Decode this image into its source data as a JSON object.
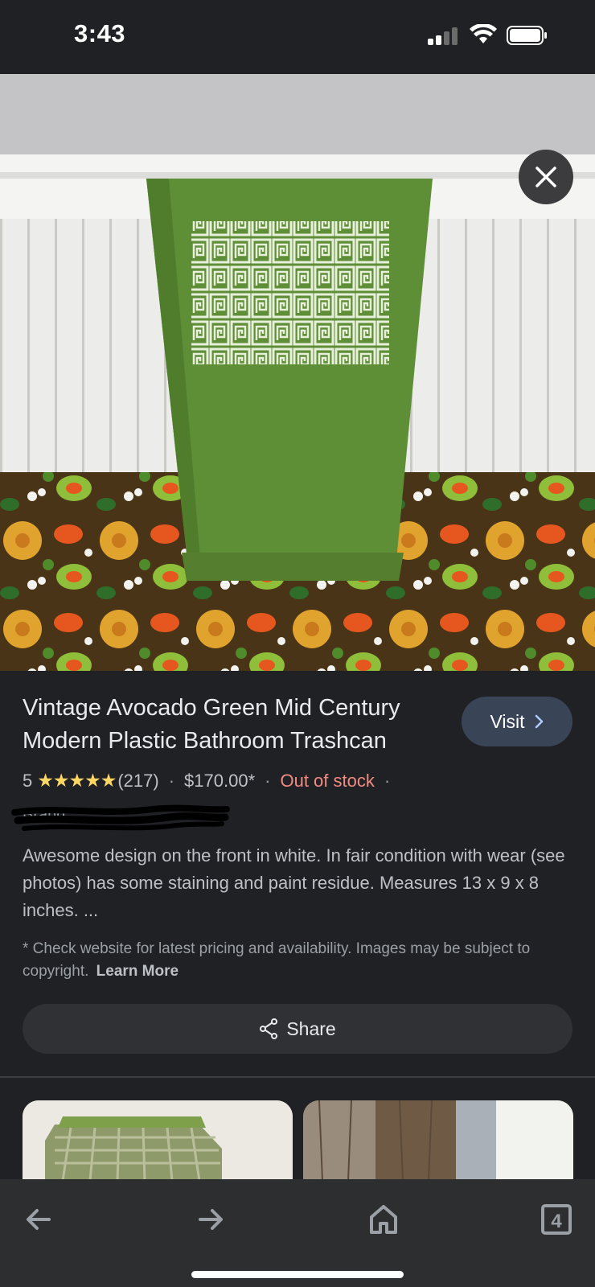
{
  "status_bar": {
    "time": "3:43"
  },
  "product": {
    "title": "Vintage Avocado Green Mid Century Modern Plastic Bathroom Trashcan",
    "rating": "5",
    "stars": "★★★★★",
    "review_count": "(217)",
    "price": "$170.00*",
    "availability": "Out of stock",
    "brand_label": "Brand",
    "description": "Awesome design on the front in white. In fair condition with wear (see photos) has some staining and paint residue. Measures 13 x 9 x 8 inches. ..."
  },
  "visit_button": {
    "label": "Visit"
  },
  "disclaimer": {
    "text": "* Check website for latest pricing and availability. Images may be subject to copyright.",
    "link": "Learn More"
  },
  "share_button": {
    "label": "Share"
  },
  "bottom_nav": {
    "tab_count": "4"
  },
  "icons": {
    "close": "close-icon",
    "visit": "chevron-right-icon",
    "share": "share-icon",
    "back": "arrow-left-icon",
    "forward": "arrow-right-icon",
    "home": "home-icon",
    "tabs": "tabs-icon"
  },
  "colors": {
    "background": "#202124",
    "visit_button": "#394457",
    "stars": "#fdd663",
    "out_of_stock": "#f28b82",
    "nav_bar": "#2d2e30"
  }
}
